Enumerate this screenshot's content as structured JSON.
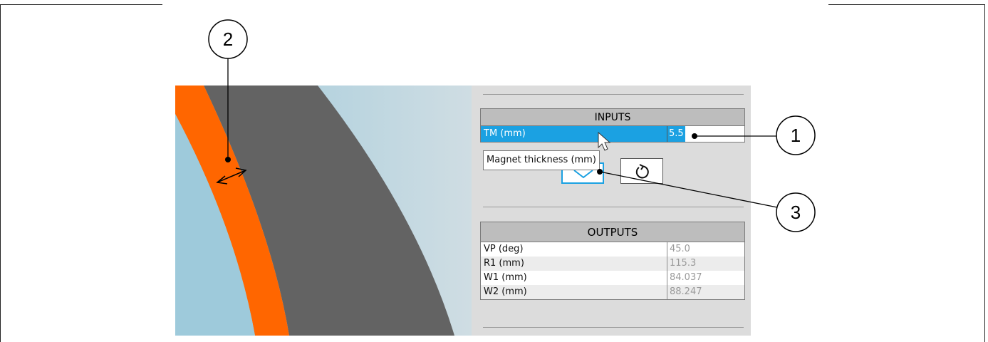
{
  "inputs": {
    "header": "INPUTS",
    "rows": [
      {
        "label": "TM (mm)",
        "value": "5.5"
      }
    ]
  },
  "tooltip": "Magnet thickness (mm)",
  "outputs": {
    "header": "OUTPUTS",
    "rows": [
      {
        "label": "VP (deg)",
        "value": "45.0"
      },
      {
        "label": "R1 (mm)",
        "value": "115.3"
      },
      {
        "label": "W1 (mm)",
        "value": "84.037"
      },
      {
        "label": "W2 (mm)",
        "value": "88.247"
      }
    ]
  },
  "callouts": {
    "one": "1",
    "two": "2",
    "three": "3"
  },
  "icons": {
    "confirm": "chevron-down-icon",
    "reset": "reset-icon",
    "cursor": "mouse-pointer-icon"
  },
  "colors": {
    "magnet": "#ff6600",
    "iron": "#636363",
    "air": "#9ecadb",
    "selection": "#1ba1e2",
    "panel": "#dcdcdc"
  }
}
